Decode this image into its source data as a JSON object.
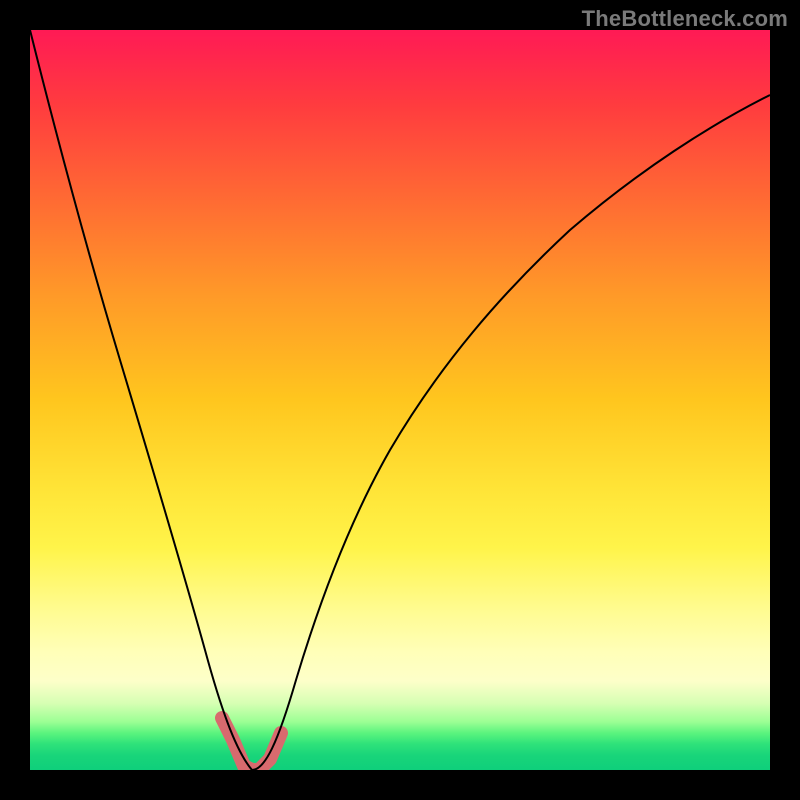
{
  "watermark": "TheBottleneck.com",
  "colors": {
    "curve": "#000000",
    "highlight": "#d86a6e",
    "gradient_top": "#ff1a55",
    "gradient_bottom": "#0fcf7b"
  },
  "chart_data": {
    "type": "line",
    "title": "",
    "xlabel": "",
    "ylabel": "",
    "xlim": [
      0,
      100
    ],
    "ylim": [
      0,
      100
    ],
    "grid": false,
    "legend": false,
    "annotations": [
      "TheBottleneck.com"
    ],
    "series": [
      {
        "name": "bottleneck-curve",
        "x": [
          0,
          5,
          10,
          15,
          20,
          24,
          27,
          29,
          30,
          31,
          32,
          34,
          36,
          40,
          45,
          50,
          58,
          66,
          75,
          85,
          95,
          100
        ],
        "y": [
          100,
          79,
          59,
          41,
          24,
          11,
          4,
          1,
          0,
          0,
          0,
          1,
          4,
          11,
          21,
          30,
          43,
          54,
          64,
          73,
          80,
          83
        ]
      },
      {
        "name": "optimal-range-highlight",
        "x": [
          26,
          27.5,
          29,
          30,
          31,
          32.5,
          34
        ],
        "y": [
          7,
          3,
          0.5,
          0,
          0,
          1.5,
          5
        ]
      }
    ]
  }
}
